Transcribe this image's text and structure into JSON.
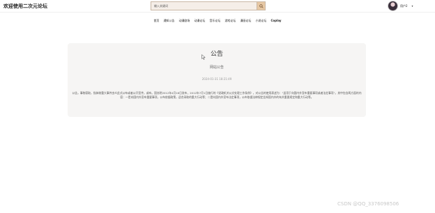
{
  "header": {
    "site_title": "欢迎使用二次元论坛",
    "search_placeholder": "输入关键词",
    "user_name": "用户2",
    "caret": "▾"
  },
  "nav": {
    "items": [
      "首页",
      "通知公告",
      "动漫剧场",
      "动漫论坛",
      "音乐论坛",
      "游戏论坛",
      "漫画论坛",
      "小说论坛",
      "Coplay"
    ]
  },
  "notice": {
    "title": "公告",
    "subtitle": "网站公告",
    "datetime": "2024-01-31 18:21:49",
    "body": "公告，事物获取，指体制重大事件由众此式公布或者公开宣传，或布。国务院2012年4月16日发布，2012年7月1日施行的《党政机关公文处理工作条例》，对公告的使用表述为：“适用于向国内外宣布重要事项或者法定事项”。其中包含两方面的内容：一是向国内外宣布重要事项，公布依据政策，适合采取的重大行动等；二是向国内外宣布法定事项，公布依据法律规定告知国内外的有关重要规定和重大行动等。"
  },
  "watermark": "CSDN @QQ_3376098506",
  "colors": {
    "search_bg": "#f5eee8",
    "search_button": "#e7c8a4",
    "card_bg": "#f6f5f4"
  },
  "icons": {
    "search": "search-icon",
    "cursor": "mouse-pointer-icon"
  }
}
